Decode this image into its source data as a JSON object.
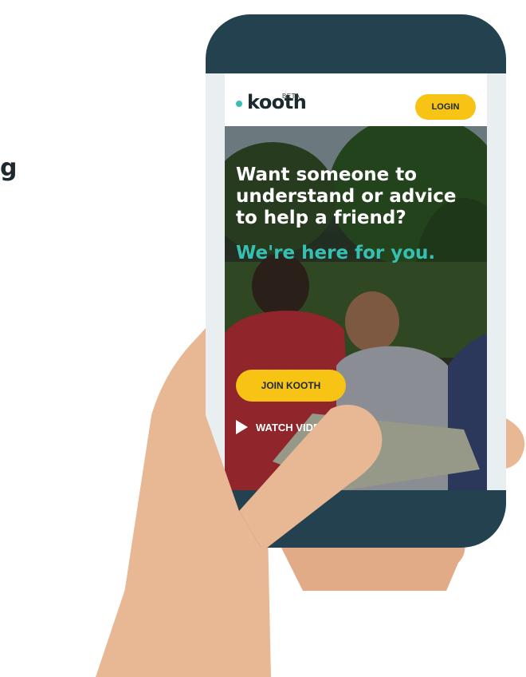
{
  "page": {
    "side_text_fragment": "g"
  },
  "app": {
    "logo_text": "kooth",
    "logo_badge": "BETA",
    "accent_color": "#37c0b2",
    "button_color": "#f7c315",
    "phone_color": "#24414f"
  },
  "header": {
    "login_label": "LOGIN"
  },
  "hero": {
    "headline": "Want someone to understand or advice to help a friend?",
    "subheadline": "We're here for you.",
    "join_label": "JOIN KOOTH",
    "watch_label": "WATCH VIDE",
    "icons": [
      "play-icon"
    ]
  }
}
